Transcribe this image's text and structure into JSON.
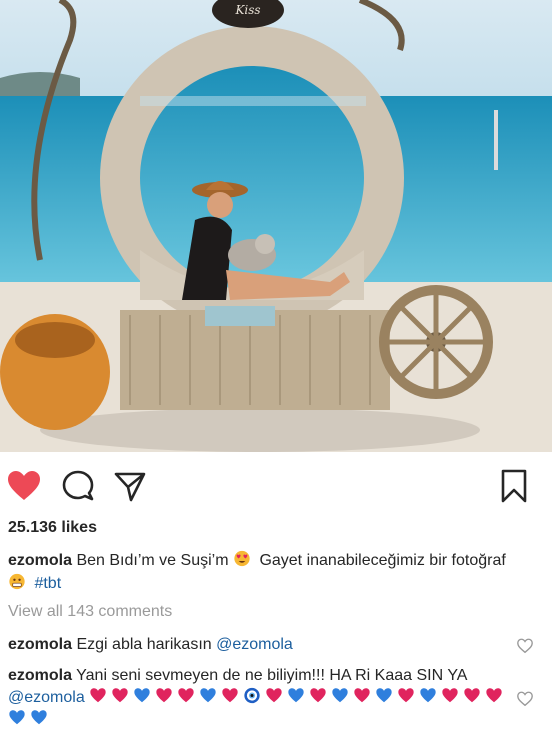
{
  "post": {
    "likes": "25.136 likes",
    "caption": {
      "username": "ezomola",
      "text1": "Ben Bıdı’m ve Suşi’m",
      "text2": "Gayet inanabileceğimiz bir fotoğraf",
      "hashtag": "#tbt"
    },
    "view_all": "View all 143 comments",
    "comments": [
      {
        "username": "ezomola",
        "text": "Ezgi abla harikasın",
        "mention": "@ezomola"
      },
      {
        "username": "ezomola",
        "text": "Yani seni sevmeyen de ne biliyim!!! HA Ri Kaaa SIN YA",
        "mention": "@ezomola"
      }
    ],
    "photo_sign": "Kiss"
  },
  "icons": {
    "like": "heart-filled-icon",
    "comment": "comment-bubble-icon",
    "share": "paper-plane-icon",
    "save": "bookmark-icon"
  },
  "colors": {
    "like_red": "#ed4956",
    "tag_blue": "#1d5f9e",
    "heart_blue": "#2f7fdd"
  }
}
